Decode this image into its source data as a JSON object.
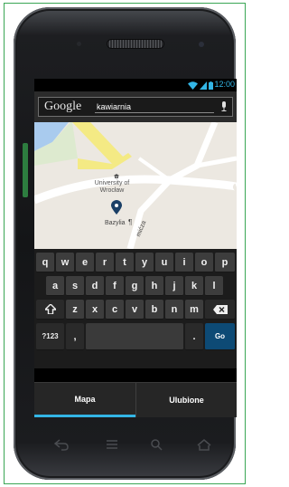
{
  "status_bar": {
    "time": "12:00"
  },
  "search": {
    "logo": "Google",
    "query": "kawiarnia"
  },
  "map": {
    "university_label": "University of Wrocław",
    "place_label": "Bazylia",
    "street_label": "mićza"
  },
  "keyboard": {
    "row1": [
      "q",
      "w",
      "e",
      "r",
      "t",
      "y",
      "u",
      "i",
      "o",
      "p"
    ],
    "row2": [
      "a",
      "s",
      "d",
      "f",
      "g",
      "h",
      "j",
      "k",
      "l"
    ],
    "row3": [
      "z",
      "x",
      "c",
      "v",
      "b",
      "n",
      "m"
    ],
    "symbols_label": "?123",
    "comma_label": ",",
    "period_label": ".",
    "go_label": "Go"
  },
  "tabs": {
    "primary": "Mapa",
    "secondary": "Ulubione"
  },
  "colors": {
    "accent": "#33b5e5",
    "frame_border": "#3aa655",
    "go_key": "#0d4a75"
  }
}
